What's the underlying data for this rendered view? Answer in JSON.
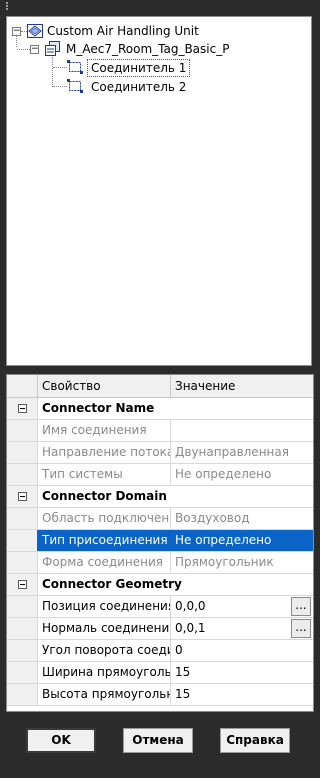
{
  "tree": {
    "root": "Custom Air Handling Unit",
    "child": "M_Aec7_Room_Tag_Basic_P",
    "items": [
      "Соединитель 1",
      "Соединитель 2"
    ]
  },
  "grid": {
    "col_property": "Свойство",
    "col_value": "Значение",
    "rows": [
      {
        "type": "category",
        "name": "Connector Name"
      },
      {
        "type": "disabled",
        "name": "Имя соединения",
        "value": ""
      },
      {
        "type": "disabled",
        "name": "Направление потока",
        "value": "Двунаправленная"
      },
      {
        "type": "disabled",
        "name": "Тип системы",
        "value": "Не определено"
      },
      {
        "type": "category",
        "name": "Connector Domain"
      },
      {
        "type": "disabled",
        "name": "Область подключения",
        "value": "Воздуховод"
      },
      {
        "type": "selected",
        "name": "Тип присоединения",
        "value": "Не определено"
      },
      {
        "type": "disabled",
        "name": "Форма соединения",
        "value": "Прямоугольник"
      },
      {
        "type": "category",
        "name": "Connector Geometry"
      },
      {
        "type": "enabled",
        "name": "Позиция соединения",
        "value": "0,0,0",
        "ellipsis": "..."
      },
      {
        "type": "enabled",
        "name": "Нормаль соединения",
        "value": "0,0,1",
        "ellipsis": "..."
      },
      {
        "type": "enabled",
        "name": "Угол поворота соеди...",
        "value": "0"
      },
      {
        "type": "enabled",
        "name": "Ширина прямоуголь...",
        "value": "15"
      },
      {
        "type": "enabled",
        "name": "Высота прямоугольн...",
        "value": "15"
      }
    ]
  },
  "buttons": {
    "ok": "OK",
    "cancel": "Отмена",
    "help": "Справка"
  },
  "colors": {
    "selection": "#0a64c8",
    "background": "#2b2b2b"
  }
}
